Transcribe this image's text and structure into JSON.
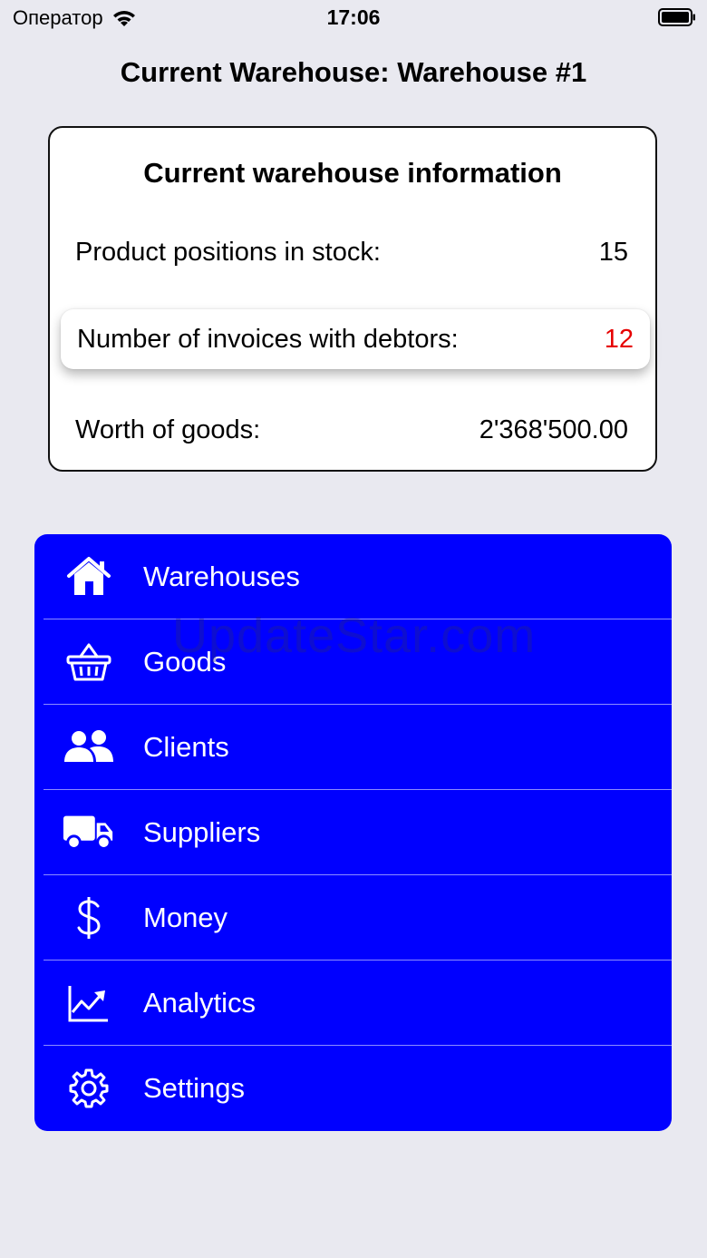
{
  "status_bar": {
    "carrier": "Оператор",
    "time": "17:06"
  },
  "page_title": "Current Warehouse: Warehouse #1",
  "info_card": {
    "title": "Current warehouse information",
    "rows": [
      {
        "label": "Product positions in stock:",
        "value": "15"
      },
      {
        "label": "Number of invoices with debtors:",
        "value": "12",
        "value_color": "#e60000"
      },
      {
        "label": "Worth of goods:",
        "value": "2'368'500.00"
      }
    ]
  },
  "menu": {
    "background": "#0000ff",
    "items": [
      {
        "label": "Warehouses",
        "icon": "house-icon"
      },
      {
        "label": "Goods",
        "icon": "basket-icon"
      },
      {
        "label": "Clients",
        "icon": "people-icon"
      },
      {
        "label": "Suppliers",
        "icon": "truck-icon"
      },
      {
        "label": "Money",
        "icon": "dollar-icon"
      },
      {
        "label": "Analytics",
        "icon": "chart-icon"
      },
      {
        "label": "Settings",
        "icon": "gear-icon"
      }
    ]
  },
  "watermark": "UpdateStar.com"
}
